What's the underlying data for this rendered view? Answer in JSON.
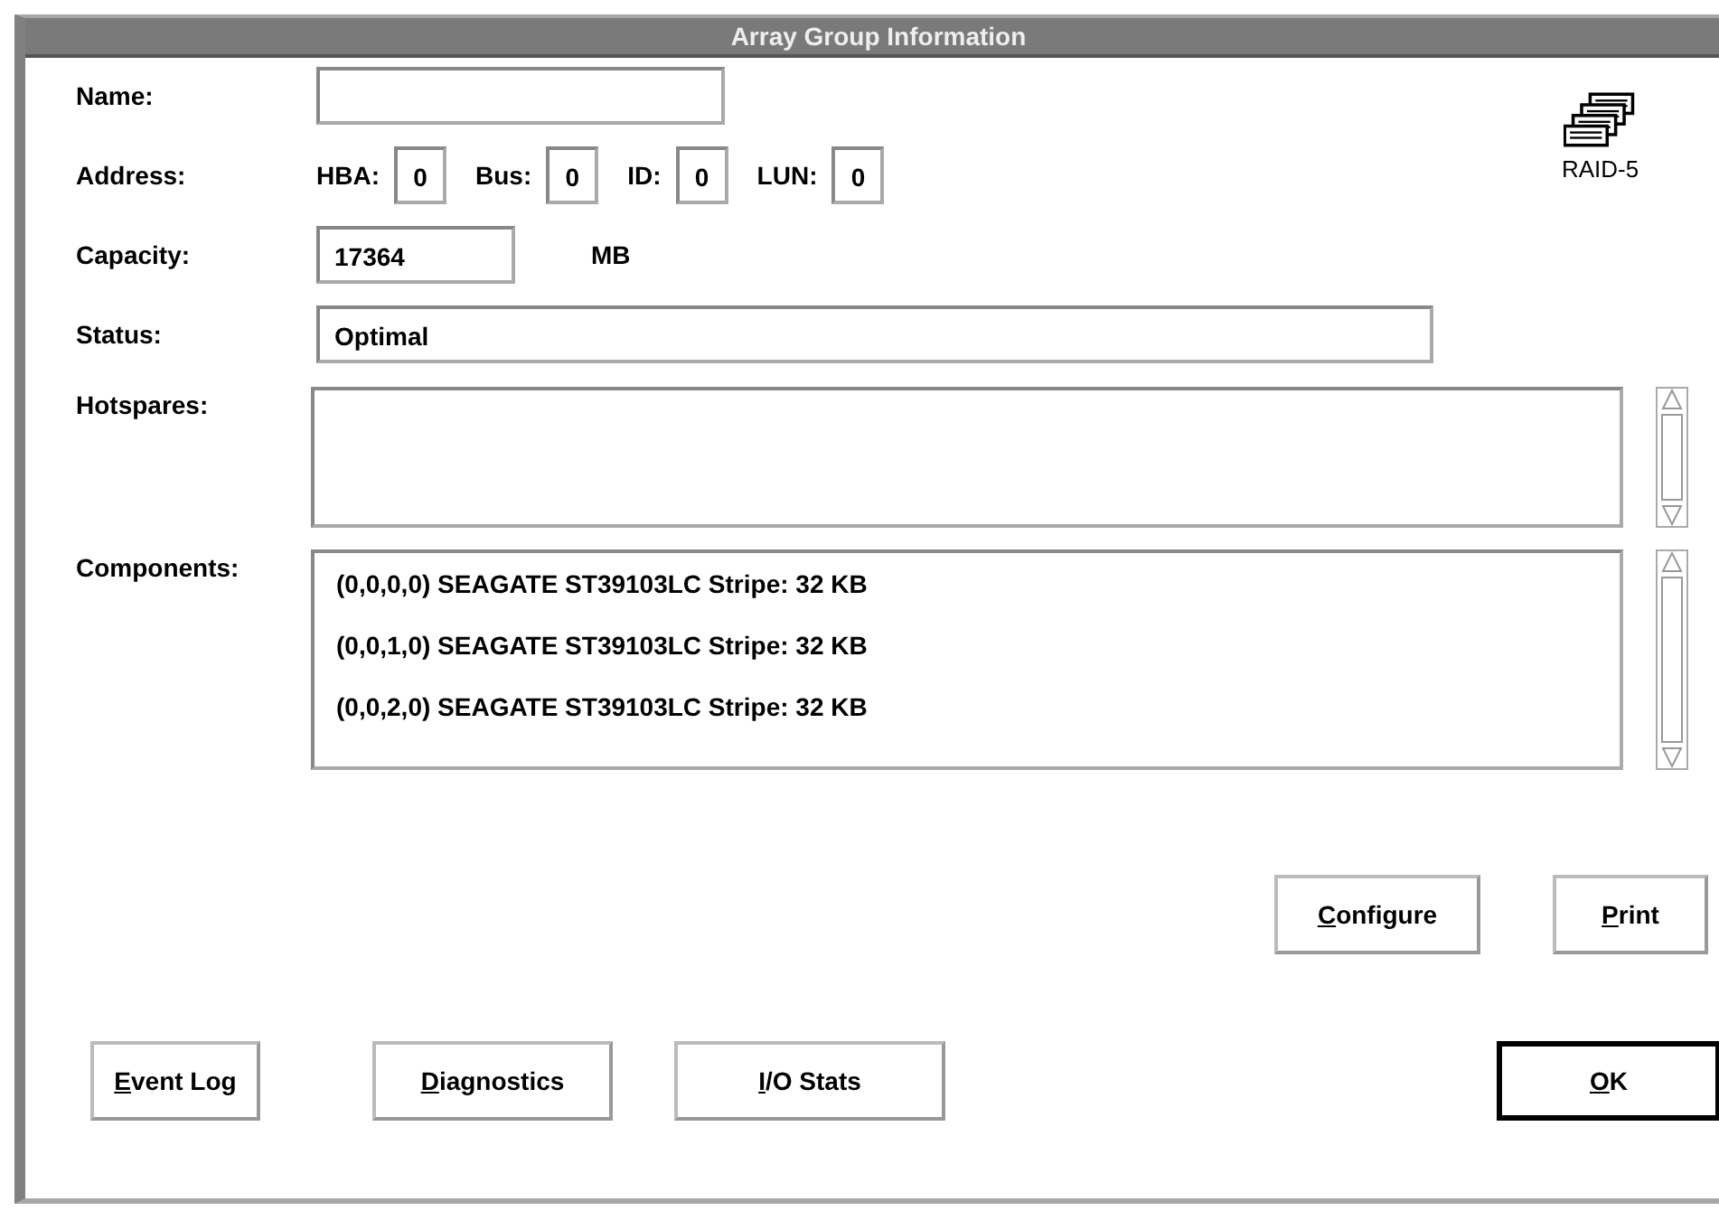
{
  "window": {
    "title": "Array Group Information"
  },
  "name": {
    "label": "Name:"
  },
  "address": {
    "label": "Address:",
    "parts": [
      {
        "label": "HBA:",
        "value": "0"
      },
      {
        "label": "Bus:",
        "value": "0"
      },
      {
        "label": "ID:",
        "value": "0"
      },
      {
        "label": "LUN:",
        "value": "0"
      }
    ]
  },
  "raid_icon": {
    "label": "RAID-5"
  },
  "capacity": {
    "label": "Capacity:",
    "value": "17364",
    "unit": "MB"
  },
  "status": {
    "label": "Status:",
    "value": "Optimal"
  },
  "hotspares": {
    "label": "Hotspares:"
  },
  "components": {
    "label": "Components:",
    "items": [
      "(0,0,0,0) SEAGATE ST39103LC  Stripe: 32 KB",
      "(0,0,1,0) SEAGATE ST39103LC  Stripe: 32 KB",
      "(0,0,2,0) SEAGATE ST39103LC  Stripe: 32 KB"
    ]
  },
  "action_buttons": [
    {
      "label": "Configure",
      "default": false
    },
    {
      "label": "Print",
      "default": false
    }
  ],
  "bottom_buttons": [
    {
      "label": "Event Log",
      "default": false
    },
    {
      "label": "Diagnostics",
      "default": false
    },
    {
      "label": "I/O Stats",
      "default": false
    },
    {
      "label": "OK",
      "default": true
    }
  ]
}
